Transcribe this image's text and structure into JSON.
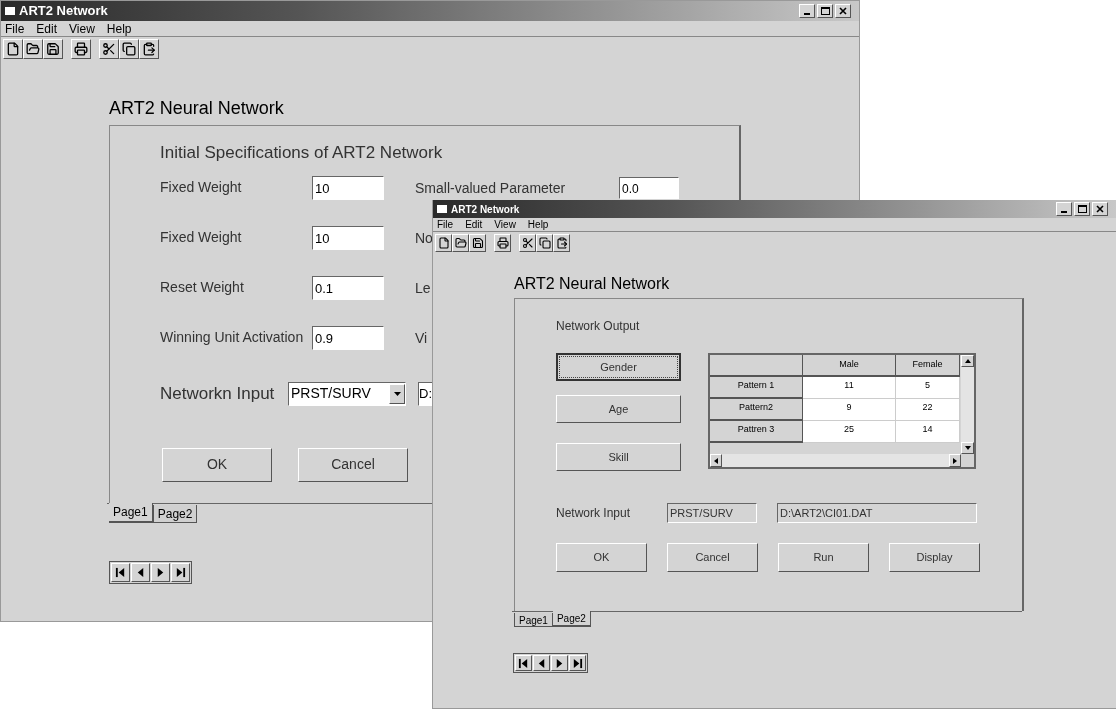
{
  "windows": [
    {
      "title": "ART2 Network",
      "menu": [
        "File",
        "Edit",
        "View",
        "Help"
      ],
      "heading": "ART2 Neural Network",
      "panel_title": "Initial Specifications of ART2 Network",
      "rows": [
        {
          "label": "Fixed Weight",
          "value": "10",
          "right_label": "Small-valued Parameter",
          "right_value": "0.0"
        },
        {
          "label": "Fixed Weight",
          "value": "10",
          "right_label": "No"
        },
        {
          "label": "Reset Weight",
          "value": "0.1",
          "right_label": "Le"
        },
        {
          "label": "Winning Unit Activation",
          "value": "0.9",
          "right_label": "Vi"
        }
      ],
      "network_input": {
        "label": "Networkn Input",
        "value": "PRST/SURV",
        "path": "D:"
      },
      "buttons": [
        "OK",
        "Cancel"
      ],
      "tabs": [
        {
          "label": "Page1",
          "selected": true
        },
        {
          "label": "Page2",
          "selected": false
        }
      ]
    },
    {
      "title": "ART2 Network",
      "menu": [
        "File",
        "Edit",
        "View",
        "Help"
      ],
      "heading": "ART2 Neural Network",
      "panel_title": "Network Output",
      "side_buttons": [
        {
          "label": "Gender",
          "focused": true
        },
        {
          "label": "Age",
          "focused": false
        },
        {
          "label": "Skill",
          "focused": false
        }
      ],
      "table": {
        "columns": [
          "Male",
          "Female"
        ],
        "rows": [
          {
            "label": "Pattern 1",
            "values": [
              "11",
              "5"
            ]
          },
          {
            "label": "Pattern2",
            "values": [
              "9",
              "22"
            ]
          },
          {
            "label": "Pattren 3",
            "values": [
              "25",
              "14"
            ]
          }
        ]
      },
      "network_input": {
        "label": "Network Input",
        "value": "PRST/SURV",
        "path": "D:\\ART2\\CI01.DAT"
      },
      "buttons": [
        "OK",
        "Cancel",
        "Run",
        "Display"
      ],
      "tabs": [
        {
          "label": "Page1",
          "selected": false
        },
        {
          "label": "Page2",
          "selected": true
        }
      ]
    }
  ]
}
